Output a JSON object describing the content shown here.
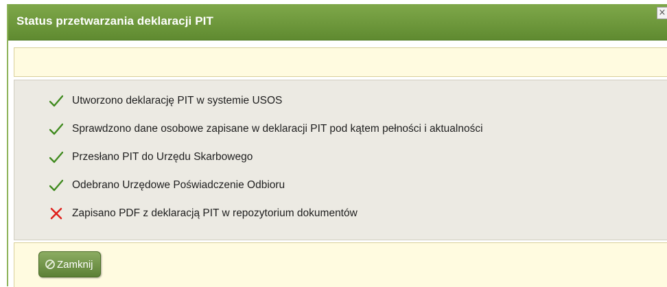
{
  "dialog": {
    "title": "Status przetwarzania deklaracji PIT",
    "close_icon": "close-icon"
  },
  "status_items": [
    {
      "label": "Utworzono deklarację PIT w systemie USOS",
      "status": "success",
      "icon": "checkmark-icon"
    },
    {
      "label": "Sprawdzono dane osobowe zapisane w deklaracji PIT pod kątem pełności i aktualności",
      "status": "success",
      "icon": "checkmark-icon"
    },
    {
      "label": "Przesłano PIT do Urzędu Skarbowego",
      "status": "success",
      "icon": "checkmark-icon"
    },
    {
      "label": "Odebrano Urzędowe Poświadczenie Odbioru",
      "status": "success",
      "icon": "checkmark-icon"
    },
    {
      "label": "Zapisano PDF z deklaracją PIT w repozytorium dokumentów",
      "status": "failure",
      "icon": "cross-icon"
    }
  ],
  "footer": {
    "close_button_label": "Zamknij",
    "close_button_icon": "cancel-circle-icon"
  },
  "colors": {
    "title_bar": "#6f9a3e",
    "success": "#3f8a1e",
    "failure": "#e0201c",
    "band": "#fffbe0",
    "panel": "#eceae3"
  }
}
